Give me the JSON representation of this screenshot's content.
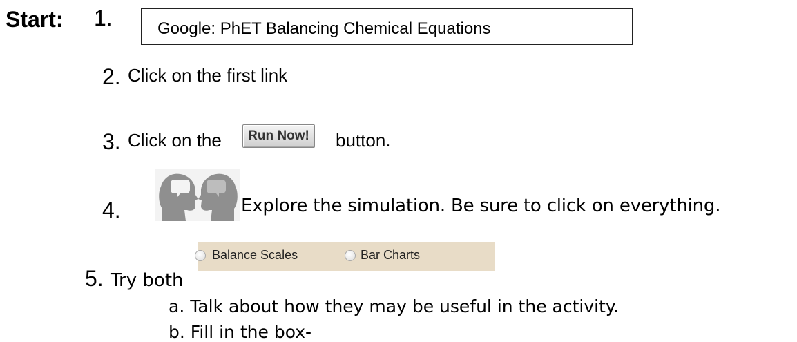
{
  "start_label": "Start:",
  "steps": {
    "step1": {
      "number": "1.",
      "box_text": "Google:   PhET Balancing Chemical Equations"
    },
    "step2": {
      "number": "2.",
      "text": "Click on the first link"
    },
    "step3": {
      "number": "3.",
      "text_before": "Click on the",
      "button_label": "Run Now!",
      "text_after": "button."
    },
    "step4": {
      "number": "4.",
      "icon": "two-heads-talking-icon",
      "text": "Explore the simulation. Be sure to click on everything."
    },
    "step5": {
      "number": "5.",
      "text_before": "Try both",
      "options": [
        "Balance Scales",
        "Bar Charts"
      ],
      "sub_items": [
        "a.  Talk about how they may be useful in the activity.",
        "b.  Fill in the box-"
      ]
    }
  },
  "colors": {
    "panel_bg": "#e8dcc7",
    "icon_gray": "#8f8f8f"
  }
}
